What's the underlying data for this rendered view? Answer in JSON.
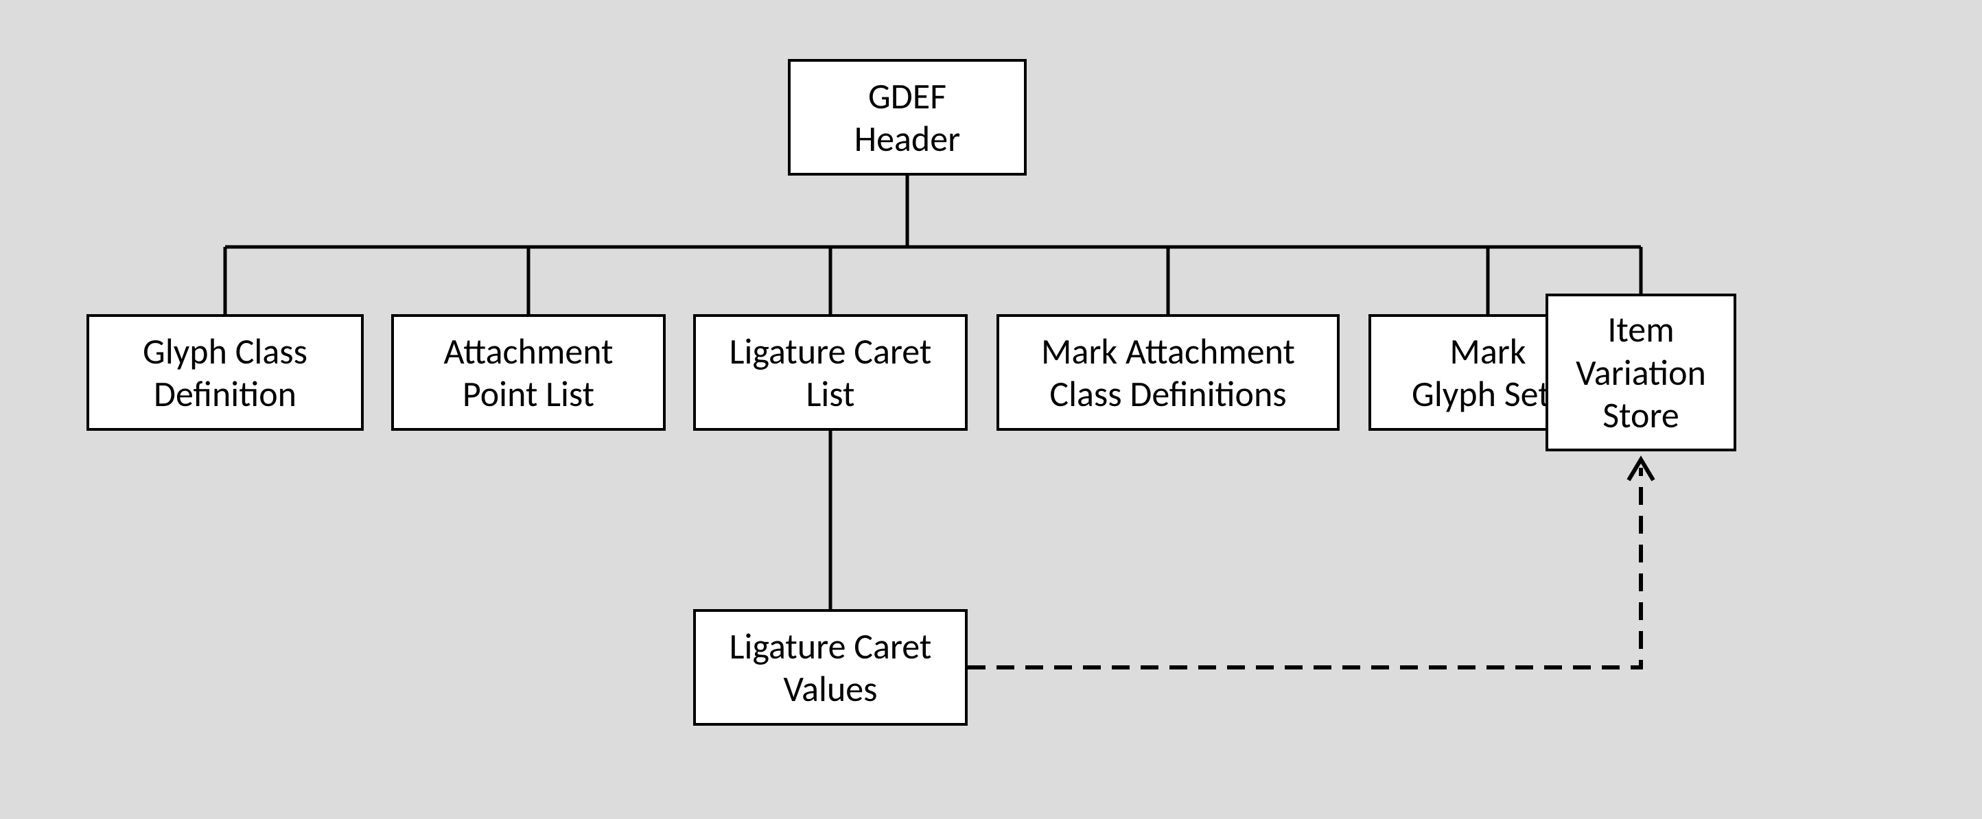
{
  "diagram": {
    "root": {
      "line1": "GDEF",
      "line2": "Header"
    },
    "children": [
      {
        "line1": "Glyph Class",
        "line2": "Definition"
      },
      {
        "line1": "Attachment",
        "line2": "Point List"
      },
      {
        "line1": "Ligature Caret",
        "line2": "List"
      },
      {
        "line1": "Mark Attachment",
        "line2": "Class Definitions"
      },
      {
        "line1": "Mark",
        "line2": "Glyph Sets"
      },
      {
        "line1": "Item",
        "line2": "Variation",
        "line3": "Store"
      }
    ],
    "grandchild": {
      "line1": "Ligature Caret",
      "line2": "Values"
    }
  }
}
